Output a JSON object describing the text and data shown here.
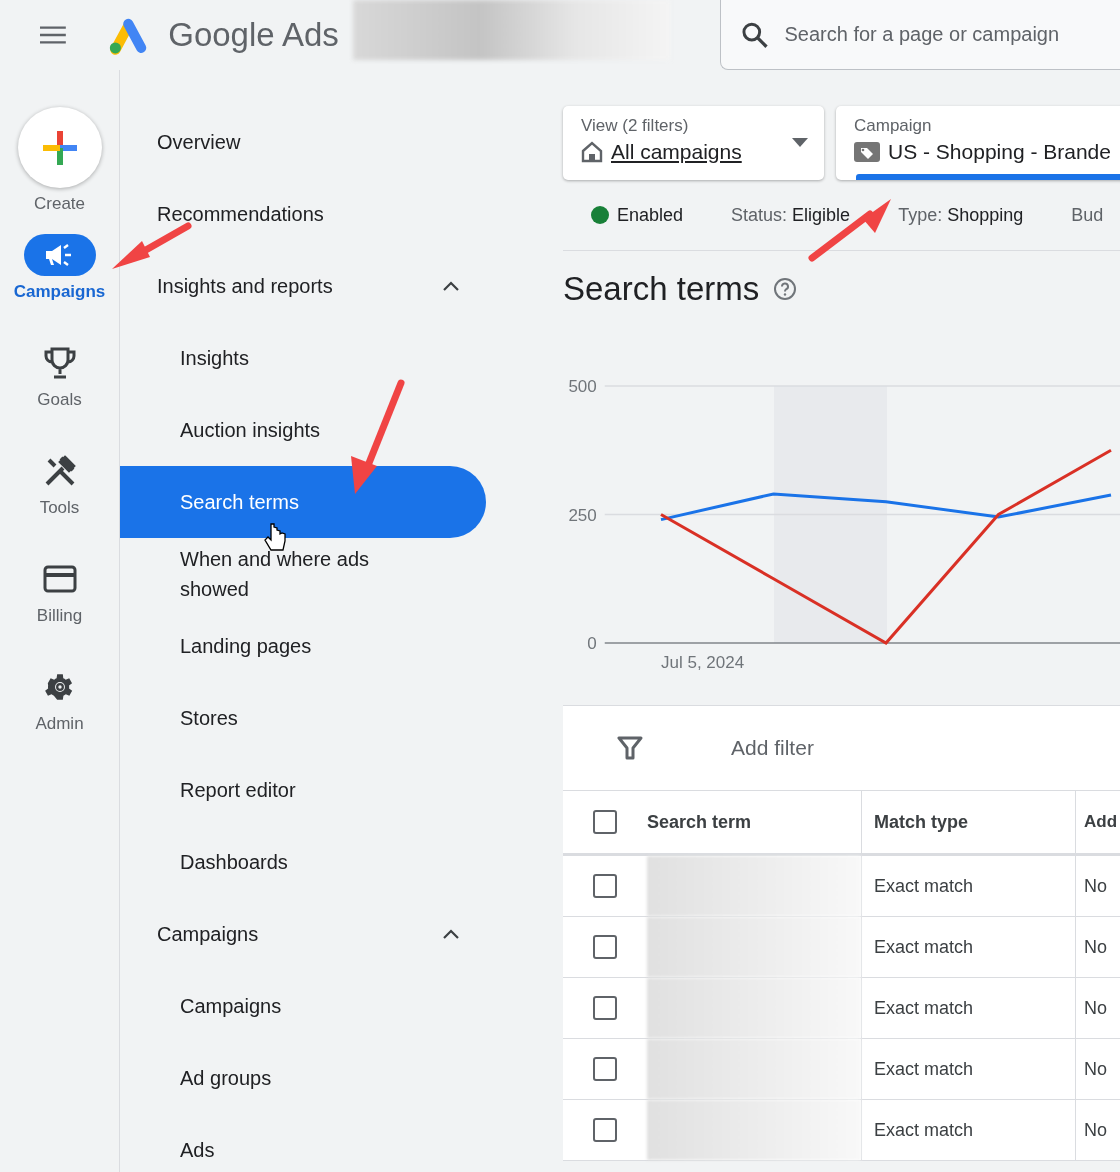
{
  "header": {
    "product": "Google Ads",
    "search": {
      "placeholder": "Search for a page or campaign"
    }
  },
  "rail": [
    {
      "kind": "create",
      "label": "Create"
    },
    {
      "kind": "campaigns",
      "label": "Campaigns",
      "selected": true
    },
    {
      "kind": "goals",
      "label": "Goals",
      "selected": false
    },
    {
      "kind": "tools",
      "label": "Tools",
      "selected": false
    },
    {
      "kind": "billing",
      "label": "Billing",
      "selected": false
    },
    {
      "kind": "admin",
      "label": "Admin",
      "selected": false
    }
  ],
  "sidebar": {
    "items": [
      {
        "label": "Overview",
        "selected": false
      },
      {
        "label": "Recommendations",
        "selected": false
      },
      {
        "label": "Insights and reports",
        "selected": false,
        "expanded": true,
        "children": [
          {
            "label": "Insights",
            "selected": false
          },
          {
            "label": "Auction insights",
            "selected": false
          },
          {
            "label": "Search terms",
            "selected": true
          },
          {
            "label": "When and where ads showed",
            "selected": false
          },
          {
            "label": "Landing pages",
            "selected": false
          },
          {
            "label": "Stores",
            "selected": false
          },
          {
            "label": "Report editor",
            "selected": false
          },
          {
            "label": "Dashboards",
            "selected": false
          }
        ]
      },
      {
        "label": "Campaigns",
        "selected": false,
        "expanded": true,
        "children": [
          {
            "label": "Campaigns",
            "selected": false
          },
          {
            "label": "Ad groups",
            "selected": false
          },
          {
            "label": "Ads",
            "selected": false
          }
        ]
      }
    ]
  },
  "filters": [
    {
      "kind": "view",
      "caption": "View (2 filters)",
      "value": "All campaigns"
    },
    {
      "kind": "campaign",
      "caption": "Campaign",
      "value": "US - Shopping - Brande"
    }
  ],
  "status_row": {
    "enabled": "Enabled",
    "fields": [
      {
        "label": "Status:",
        "value": "Eligible"
      },
      {
        "label": "Type:",
        "value": "Shopping"
      },
      {
        "label": "Bud"
      }
    ]
  },
  "page_title": "Search terms",
  "chart_data": {
    "type": "line",
    "categories": [
      "Jul 5, 2024",
      null,
      null,
      null,
      null,
      null
    ],
    "ylim": [
      0,
      500
    ],
    "yticks": [
      {
        "value": 0,
        "label": "0"
      },
      {
        "value": 250,
        "label": "250"
      },
      {
        "value": 500,
        "label": "500"
      }
    ],
    "series": [
      {
        "color": "#1a73e8",
        "values": [
          240,
          290,
          275,
          245,
          288,
          null
        ]
      },
      {
        "color": "#d93025",
        "values": [
          250,
          125,
          0,
          250,
          375,
          null
        ]
      }
    ]
  },
  "table": {
    "add_filter": "Add filter",
    "columns": [
      "Search term",
      "Match type",
      "Add"
    ],
    "header_checked": false,
    "rows": [
      {
        "checked": false,
        "match_type": "Exact match",
        "column_3": "No"
      },
      {
        "checked": false,
        "match_type": "Exact match",
        "column_3": "No"
      },
      {
        "checked": false,
        "match_type": "Exact match",
        "column_3": "No"
      },
      {
        "checked": false,
        "match_type": "Exact match",
        "column_3": "No"
      },
      {
        "checked": false,
        "match_type": "Exact match",
        "column_3": "No"
      }
    ]
  }
}
